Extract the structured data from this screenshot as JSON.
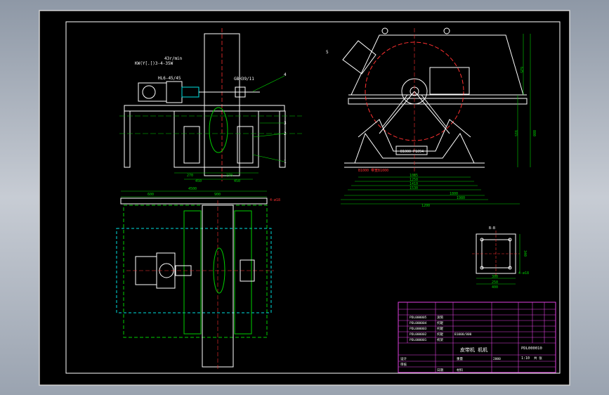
{
  "drawing": {
    "speed_label": "43r/min",
    "motor_label": "KW(Y[.[)3-4-35W",
    "coupling_label": "HL6-45/45",
    "bearing_label": "GBH39/11",
    "part_numbers": [
      "1",
      "2",
      "3",
      "4",
      "5"
    ],
    "dims_top_left": [
      "270",
      "270",
      "450",
      "450"
    ],
    "dims_plan": [
      "600",
      "900",
      "4500"
    ],
    "dims_right_vertical": [
      "625",
      "915",
      "880"
    ],
    "dims_right_horizontal": [
      "1085",
      "1250",
      "1410",
      "1530",
      "1800",
      "1980",
      "2000",
      "1200"
    ],
    "belt_label": "B1000 P1094",
    "belt_note": "B1000 带宽B1000",
    "hole_label": "4-ø18",
    "detail_title": "B-B",
    "detail_dims": [
      "340",
      "300",
      "250",
      "400"
    ],
    "detail_hole": "4-ø18"
  },
  "title_block": {
    "title": "皮带机 机机",
    "drawing_no": "PDL000010",
    "scale": "1:10",
    "sheet": "共 张",
    "rows": [
      {
        "no": "PDL000005",
        "name": "滚筒"
      },
      {
        "no": "PDL000004",
        "name": "托辊"
      },
      {
        "no": "PDL000003",
        "name": "托辊"
      },
      {
        "no": "PDL000002",
        "name": "托辊"
      },
      {
        "no": "PDL000001",
        "name": "机架"
      }
    ],
    "parts_header": "B1000/800",
    "designer_label": "设计",
    "check_label": "审核",
    "date_label": "日期",
    "weight_label": "重量",
    "material_label": "材料",
    "extra": "2000"
  },
  "colors": {
    "frame": "#e0e0e0",
    "paper": "#000000",
    "line": "#ffffff",
    "green": "#00d000",
    "red": "#ff3030",
    "magenta": "#e040e0",
    "cyan": "#00e0e0",
    "yellow": "#e0e000"
  }
}
